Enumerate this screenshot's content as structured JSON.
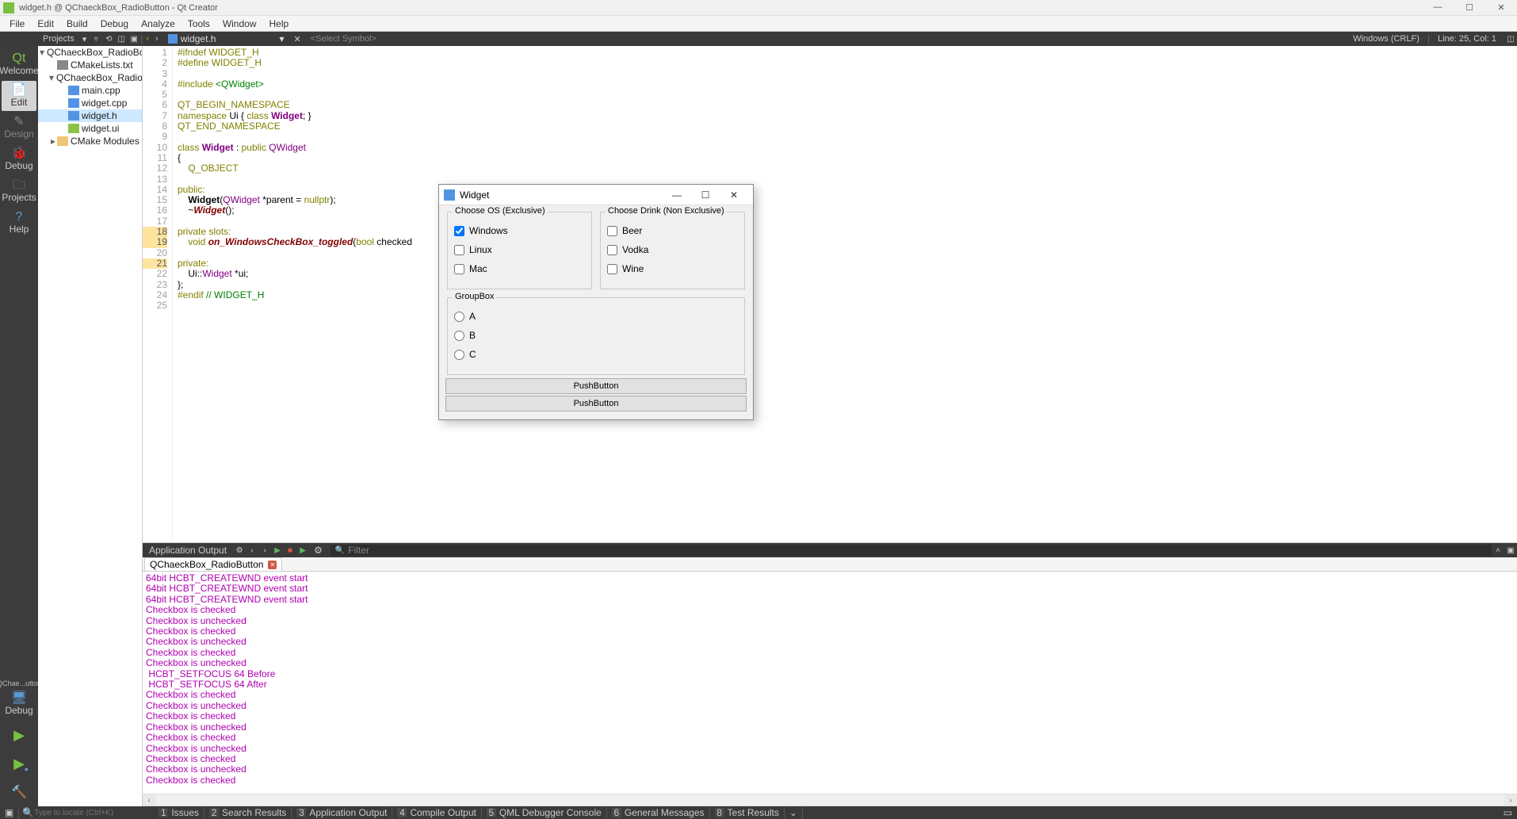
{
  "titlebar": {
    "text": "widget.h @ QChaeckBox_RadioButton - Qt Creator"
  },
  "menu": [
    "File",
    "Edit",
    "Build",
    "Debug",
    "Analyze",
    "Tools",
    "Window",
    "Help"
  ],
  "navtool": {
    "projects": "Projects",
    "file": "widget.h",
    "symbol": "<Select Symbol>",
    "encoding": "Windows (CRLF)",
    "pos": "Line: 25, Col: 1"
  },
  "modes": {
    "welcome": "Welcome",
    "edit": "Edit",
    "design": "Design",
    "debug": "Debug",
    "projects": "Projects",
    "help": "Help",
    "kit": "QChae...utton",
    "kit2": "Debug"
  },
  "tree": {
    "root": "QChaeckBox_RadioBo",
    "cmake": "CMakeLists.txt",
    "sub": "QChaeckBox_Radio",
    "main": "main.cpp",
    "wcpp": "widget.cpp",
    "wh": "widget.h",
    "wui": "widget.ui",
    "mods": "CMake Modules"
  },
  "code": {
    "lines": [
      {
        "n": 1,
        "t": "#ifndef WIDGET_H",
        "cls": "pre"
      },
      {
        "n": 2,
        "t": "#define WIDGET_H",
        "cls": "pre"
      },
      {
        "n": 3,
        "t": "",
        "cls": ""
      },
      {
        "n": 4,
        "t": "#include <QWidget>",
        "cls": "inc"
      },
      {
        "n": 5,
        "t": "",
        "cls": ""
      },
      {
        "n": 6,
        "t": "QT_BEGIN_NAMESPACE",
        "cls": "macro"
      },
      {
        "n": 7,
        "t": "namespace Ui { class Widget; }",
        "cls": "ns"
      },
      {
        "n": 8,
        "t": "QT_END_NAMESPACE",
        "cls": "macro"
      },
      {
        "n": 9,
        "t": "",
        "cls": ""
      },
      {
        "n": 10,
        "t": "class Widget : public QWidget",
        "cls": "cls"
      },
      {
        "n": 11,
        "t": "{",
        "cls": ""
      },
      {
        "n": 12,
        "t": "    Q_OBJECT",
        "cls": "macro"
      },
      {
        "n": 13,
        "t": "",
        "cls": ""
      },
      {
        "n": 14,
        "t": "public:",
        "cls": "kw"
      },
      {
        "n": 15,
        "t": "    Widget(QWidget *parent = nullptr);",
        "cls": "ctor"
      },
      {
        "n": 16,
        "t": "    ~Widget();",
        "cls": "dtor"
      },
      {
        "n": 17,
        "t": "",
        "cls": ""
      },
      {
        "n": 18,
        "t": "private slots:",
        "cls": "kw",
        "hl": true
      },
      {
        "n": 19,
        "t": "    void on_WindowsCheckBox_toggled(bool checked",
        "cls": "slot",
        "hl": true
      },
      {
        "n": 20,
        "t": "",
        "cls": ""
      },
      {
        "n": 21,
        "t": "private:",
        "cls": "kw",
        "hl": true
      },
      {
        "n": 22,
        "t": "    Ui::Widget *ui;",
        "cls": "mem"
      },
      {
        "n": 23,
        "t": "};",
        "cls": ""
      },
      {
        "n": 24,
        "t": "#endif // WIDGET_H",
        "cls": "endif"
      },
      {
        "n": 25,
        "t": "",
        "cls": ""
      }
    ]
  },
  "widget": {
    "title": "Widget",
    "os_title": "Choose OS (Exclusive)",
    "os": [
      "Windows",
      "Linux",
      "Mac"
    ],
    "drink_title": "Choose Drink (Non Exclusive)",
    "drink": [
      "Beer",
      "Vodka",
      "Wine"
    ],
    "gb_title": "GroupBox",
    "radios": [
      "A",
      "B",
      "C"
    ],
    "btn1": "PushButton",
    "btn2": "PushButton"
  },
  "output": {
    "header": "Application Output",
    "tab": "QChaeckBox_RadioButton",
    "filter_ph": "Filter",
    "lines": [
      "64bit HCBT_CREATEWND event start",
      "64bit HCBT_CREATEWND event start",
      "64bit HCBT_CREATEWND event start",
      "Checkbox is checked",
      "Checkbox is unchecked",
      "Checkbox is checked",
      "Checkbox is unchecked",
      "Checkbox is checked",
      "Checkbox is unchecked",
      " HCBT_SETFOCUS 64 Before",
      " HCBT_SETFOCUS 64 After",
      "Checkbox is checked",
      "Checkbox is unchecked",
      "Checkbox is checked",
      "Checkbox is unchecked",
      "Checkbox is checked",
      "Checkbox is unchecked",
      "Checkbox is checked",
      "Checkbox is unchecked",
      "Checkbox is checked"
    ]
  },
  "status": {
    "locator_ph": "Type to locate (Ctrl+K)",
    "items": [
      {
        "n": "1",
        "t": "Issues"
      },
      {
        "n": "2",
        "t": "Search Results"
      },
      {
        "n": "3",
        "t": "Application Output"
      },
      {
        "n": "4",
        "t": "Compile Output"
      },
      {
        "n": "5",
        "t": "QML Debugger Console"
      },
      {
        "n": "6",
        "t": "General Messages"
      },
      {
        "n": "8",
        "t": "Test Results"
      }
    ]
  }
}
